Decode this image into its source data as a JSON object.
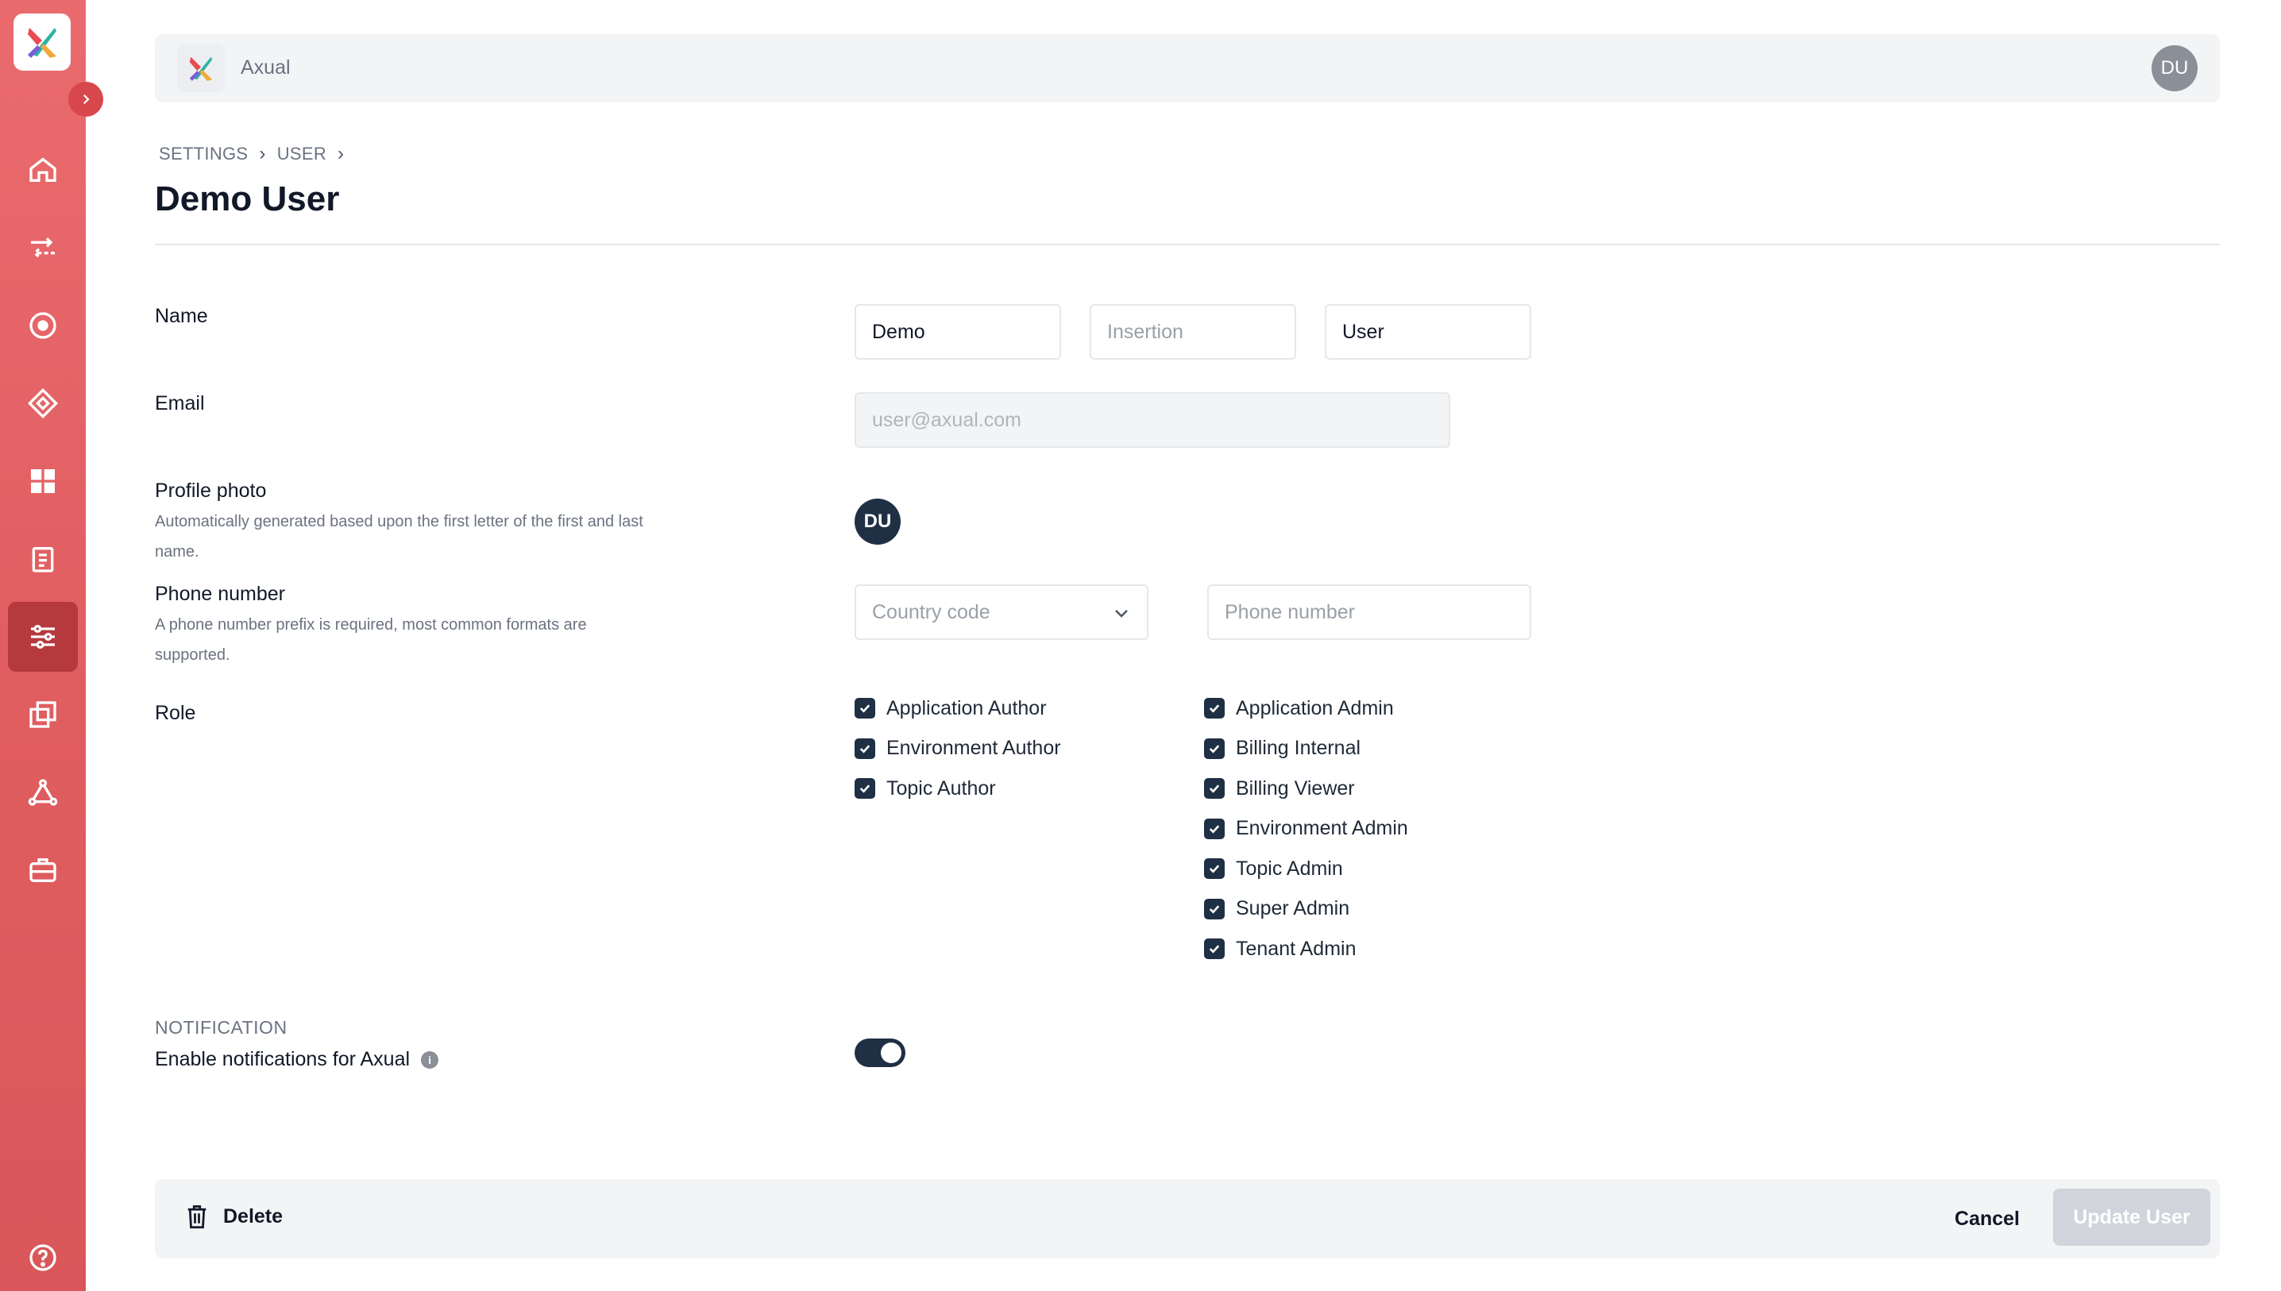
{
  "app": {
    "brand_name": "Axual",
    "user_initials": "DU"
  },
  "sidebar": {
    "items": [
      {
        "name": "home-icon"
      },
      {
        "name": "streams-icon"
      },
      {
        "name": "target-icon"
      },
      {
        "name": "diamond-icon"
      },
      {
        "name": "dashboard-icon"
      },
      {
        "name": "clipboard-icon"
      },
      {
        "name": "settings-sliders-icon",
        "active": true
      },
      {
        "name": "copy-icon"
      },
      {
        "name": "network-icon"
      },
      {
        "name": "toolbox-icon"
      }
    ],
    "help_icon": "help-icon"
  },
  "breadcrumb": {
    "level1": "SETTINGS",
    "level2": "USER"
  },
  "page": {
    "title": "Demo User"
  },
  "form": {
    "name": {
      "label": "Name",
      "first": "Demo",
      "insertion_placeholder": "Insertion",
      "last": "User"
    },
    "email": {
      "label": "Email",
      "value": "user@axual.com"
    },
    "profile_photo": {
      "label": "Profile photo",
      "hint": "Automatically generated based upon the first letter of the first and last name.",
      "initials": "DU"
    },
    "phone": {
      "label": "Phone number",
      "hint": "A phone number prefix is required, most common formats are supported.",
      "country_placeholder": "Country code",
      "number_placeholder": "Phone number"
    },
    "role": {
      "label": "Role",
      "col1": [
        "Application Author",
        "Environment Author",
        "Topic Author"
      ],
      "col2": [
        "Application Admin",
        "Billing Internal",
        "Billing Viewer",
        "Environment Admin",
        "Topic Admin",
        "Super Admin",
        "Tenant Admin"
      ]
    }
  },
  "notification": {
    "section": "NOTIFICATION",
    "label": "Enable notifications for Axual",
    "enabled": true
  },
  "footer": {
    "delete": "Delete",
    "cancel": "Cancel",
    "update": "Update User"
  },
  "colors": {
    "sidebar": "#e05d60",
    "active_nav": "#b5393d",
    "checkbox": "#1f2f44"
  }
}
